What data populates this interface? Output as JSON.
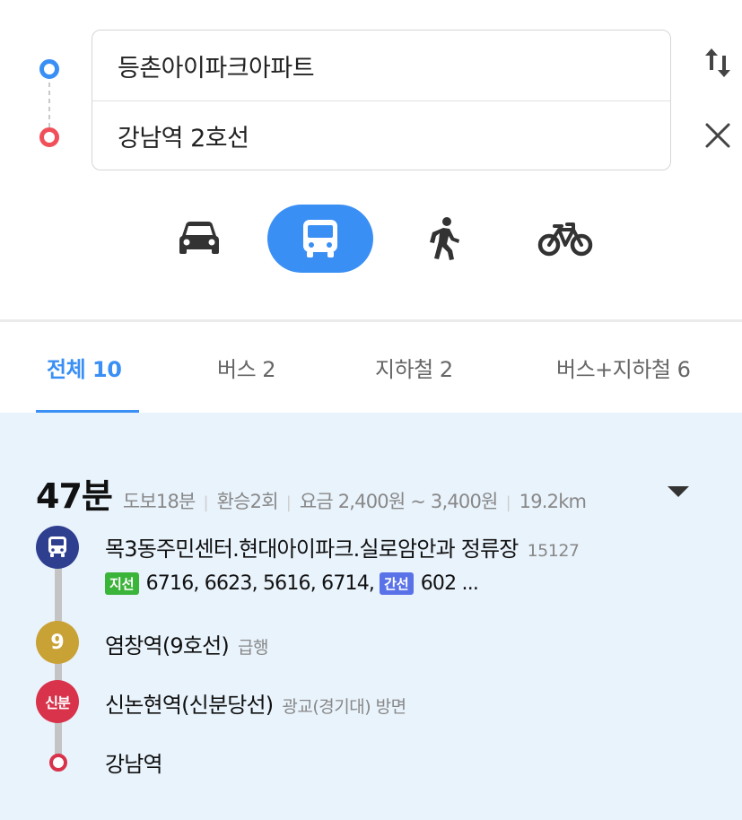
{
  "search": {
    "origin": "등촌아이파크아파트",
    "destination": "강남역 2호선"
  },
  "modes": [
    {
      "id": "car",
      "icon": "car-icon",
      "selected": false
    },
    {
      "id": "bus",
      "icon": "bus-icon",
      "selected": true
    },
    {
      "id": "walk",
      "icon": "walk-icon",
      "selected": false
    },
    {
      "id": "bike",
      "icon": "bike-icon",
      "selected": false
    }
  ],
  "tabs": [
    {
      "label": "전체 10",
      "active": true
    },
    {
      "label": "버스 2",
      "active": false
    },
    {
      "label": "지하철 2",
      "active": false
    },
    {
      "label": "버스+지하철 6",
      "active": false
    }
  ],
  "result": {
    "total_time": "47분",
    "walk": "도보18분",
    "transfers": "환승2회",
    "fare": "요금 2,400원 ~ 3,400원",
    "distance": "19.2km",
    "stops": [
      {
        "badge": "",
        "badge_icon": "bus-icon",
        "badge_color": "#2f3f8f",
        "name": "목3동주민센터.현대아이파크.실로암안과 정류장",
        "sub": "15127",
        "lines": {
          "branch_label": "지선",
          "branch_routes": "6716, 6623, 5616, 6714,",
          "trunk_label": "간선",
          "trunk_routes": "602 ..."
        }
      },
      {
        "badge": "9",
        "badge_color": "#c9a236",
        "name": "염창역(9호선)",
        "sub": "급행"
      },
      {
        "badge": "신분",
        "badge_color": "#d8334b",
        "name": "신논현역(신분당선)",
        "sub": "광교(경기대) 방면"
      },
      {
        "badge": "",
        "badge_color": "#d8334b",
        "name": "강남역",
        "sub": ""
      }
    ]
  },
  "colors": {
    "accent": "#3a8ff5",
    "origin_dot": "#3a8ff5",
    "destination_dot": "#f0505a",
    "result_bg": "#e9f3fc"
  }
}
